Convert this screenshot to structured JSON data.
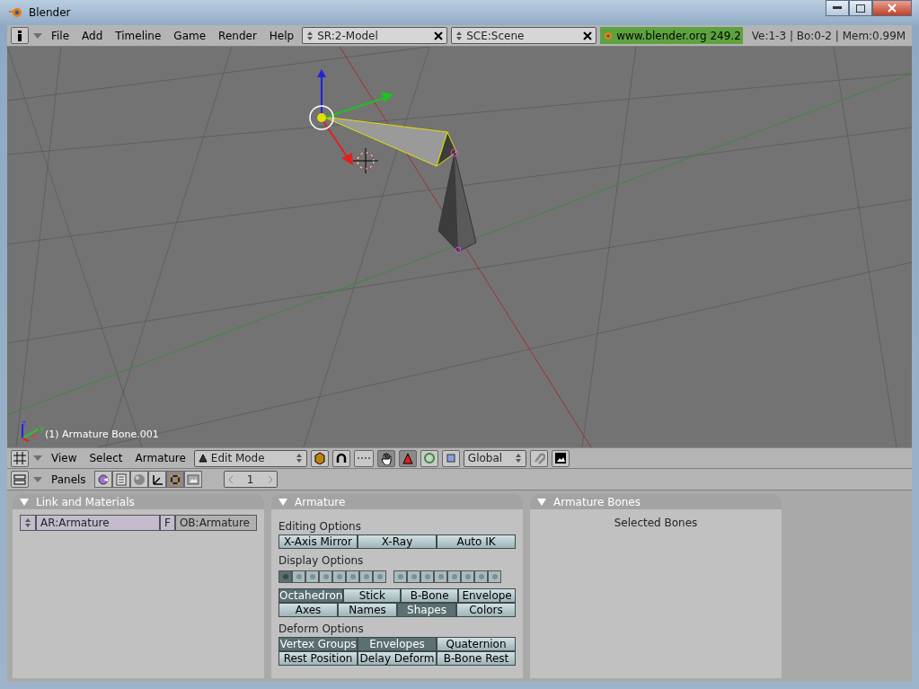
{
  "window": {
    "title": "Blender"
  },
  "top_header": {
    "menus": [
      "File",
      "Add",
      "Timeline",
      "Game",
      "Render",
      "Help"
    ],
    "screen": "SR:2-Model",
    "scene": "SCE:Scene",
    "url": "www.blender.org 249.2",
    "stats": "Ve:1-3 | Bo:0-2 | Mem:0.99M"
  },
  "viewport": {
    "object_label": "(1) Armature Bone.001",
    "axis_labels": [
      "z",
      "y",
      "x"
    ]
  },
  "view3d_header": {
    "menus": [
      "View",
      "Select",
      "Armature"
    ],
    "mode": "Edit Mode",
    "orientation": "Global",
    "manipulators": [
      {
        "kind": "hand",
        "selected": true
      },
      {
        "kind": "translate",
        "selected": true
      },
      {
        "kind": "rotate",
        "selected": false
      },
      {
        "kind": "scale",
        "selected": false
      }
    ]
  },
  "buttons_header": {
    "label": "Panels",
    "context_tabs": [
      {
        "kind": "logic",
        "selected": false
      },
      {
        "kind": "script",
        "selected": false
      },
      {
        "kind": "shading",
        "selected": false
      },
      {
        "kind": "object",
        "selected": false
      },
      {
        "kind": "editing",
        "selected": true
      },
      {
        "kind": "scene",
        "selected": false
      }
    ],
    "frame": "1"
  },
  "panels": {
    "link_materials": {
      "title": "Link and Materials",
      "data": "AR:Armature",
      "fake": "F",
      "object": "OB:Armature"
    },
    "armature": {
      "title": "Armature",
      "sections": [
        {
          "title": "Editing Options",
          "rows": [
            [
              {
                "label": "X-Axis Mirror",
                "selected": false
              },
              {
                "label": "X-Ray",
                "selected": false
              },
              {
                "label": "Auto IK",
                "selected": false
              }
            ]
          ]
        },
        {
          "title": "Display Options",
          "layers": [
            true,
            false,
            false,
            false,
            false,
            false,
            false,
            false,
            false,
            false,
            false,
            false,
            false,
            false,
            false,
            false
          ],
          "rows": [
            [
              {
                "label": "Octahedron",
                "selected": true
              },
              {
                "label": "Stick",
                "selected": false
              },
              {
                "label": "B-Bone",
                "selected": false
              },
              {
                "label": "Envelope",
                "selected": false
              }
            ],
            [
              {
                "label": "Axes",
                "selected": false
              },
              {
                "label": "Names",
                "selected": false
              },
              {
                "label": "Shapes",
                "selected": true
              },
              {
                "label": "Colors",
                "selected": false
              }
            ]
          ]
        },
        {
          "title": "Deform Options",
          "rows": [
            [
              {
                "label": "Vertex Groups",
                "selected": true
              },
              {
                "label": "Envelopes",
                "selected": true
              },
              {
                "label": "Quaternion",
                "selected": false
              }
            ],
            [
              {
                "label": "Rest Position",
                "selected": false
              },
              {
                "label": "Delay Deform",
                "selected": false
              },
              {
                "label": "B-Bone Rest",
                "selected": false
              }
            ]
          ]
        }
      ]
    },
    "bones": {
      "title": "Armature Bones",
      "text": "Selected Bones"
    }
  }
}
